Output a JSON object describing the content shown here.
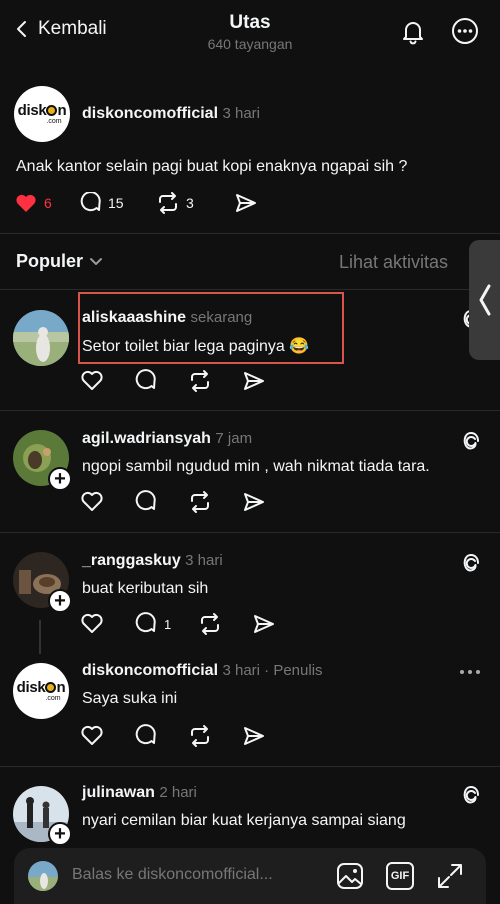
{
  "header": {
    "back_label": "Kembali",
    "title": "Utas",
    "views": "640 tayangan"
  },
  "main_post": {
    "username": "diskoncomofficial",
    "time": "3 hari",
    "text": "Anak kantor selain pagi buat kopi enaknya ngapai sih ?",
    "likes": "6",
    "replies": "15",
    "reposts": "3",
    "logo_text": "disk n",
    "logo_sub": ".com"
  },
  "sort": {
    "label": "Populer",
    "activity_label": "Lihat aktivitas"
  },
  "replies": [
    {
      "username": "aliskaaashine",
      "time": "sekarang",
      "text": "Setor toilet biar lega paginya 😂"
    },
    {
      "username": "agil.wadriansyah",
      "time": "7 jam",
      "text": "ngopi sambil ngudud min , wah nikmat tiada tara."
    },
    {
      "username": "_ranggaskuy",
      "time": "3 hari",
      "text": "buat keributan sih",
      "reply_count": "1"
    },
    {
      "username": "diskoncomofficial",
      "time": "3 hari · Penulis",
      "text": "Saya suka ini"
    },
    {
      "username": "julinawan",
      "time": "2 hari",
      "text": "nyari cemilan biar kuat kerjanya sampai siang"
    }
  ],
  "reply_bar": {
    "placeholder": "Balas ke diskoncomofficial...",
    "gif_label": "GIF"
  },
  "colors": {
    "background": "#101010",
    "like_red": "#ff3040",
    "highlight": "#d9544a"
  }
}
